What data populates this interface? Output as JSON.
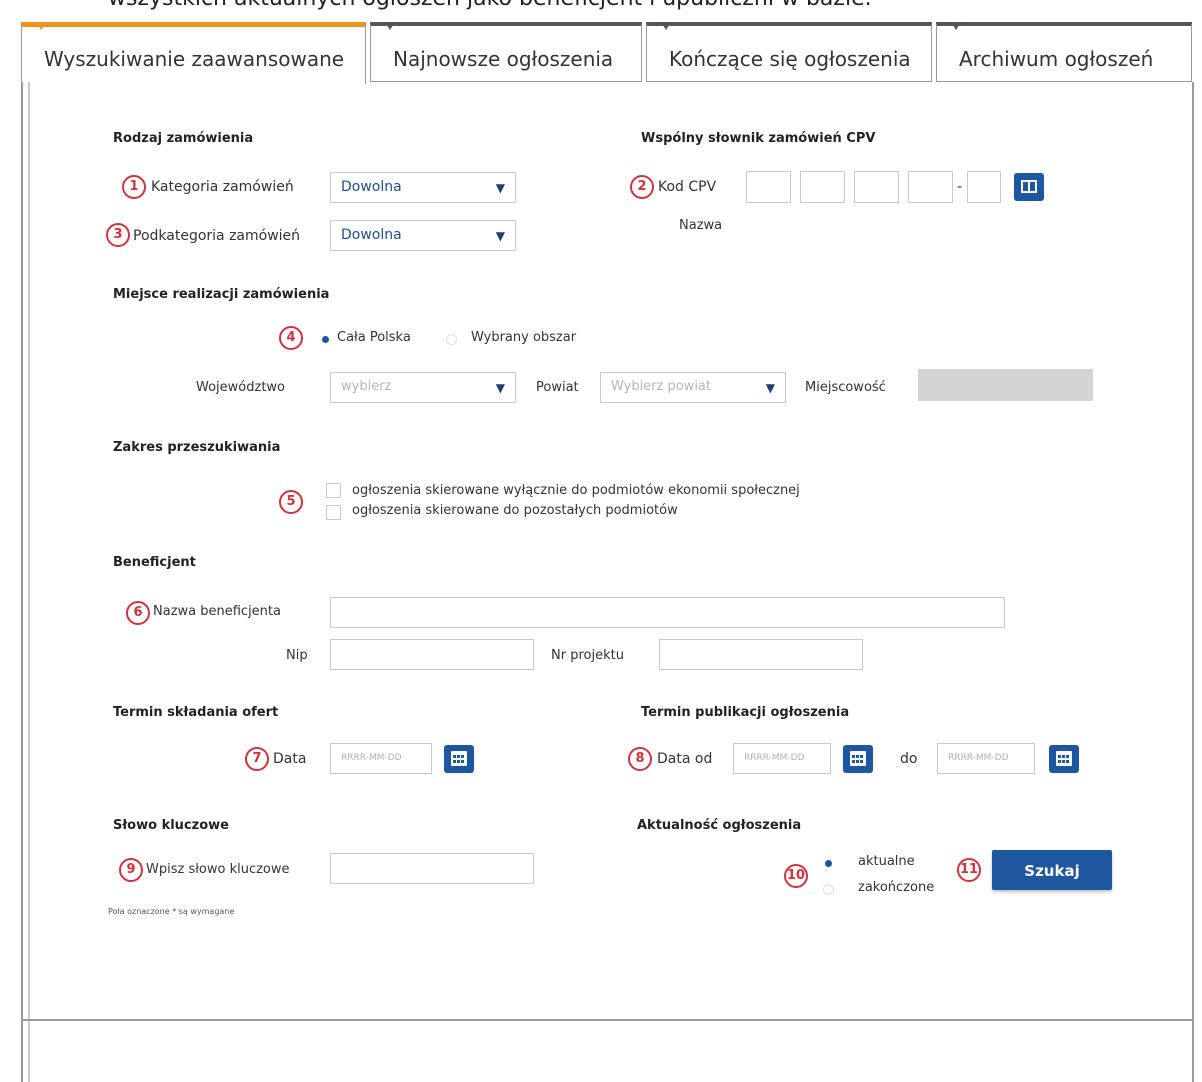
{
  "top_caption": "wszystkich aktualnych ogłoszeń jako beneficjent i upubliczni w bazie.",
  "tabs": [
    {
      "label": "Wyszukiwanie zaawansowane"
    },
    {
      "label": "Najnowsze ogłoszenia"
    },
    {
      "label": "Kończące się ogłoszenia"
    },
    {
      "label": "Archiwum ogłoszeń"
    }
  ],
  "order_type": {
    "title": "Rodzaj zamówienia",
    "category_label": "Kategoria zamówień",
    "category_value": "Dowolna",
    "subcategory_label": "Podkategoria zamówień",
    "subcategory_value": "Dowolna"
  },
  "cpv": {
    "title": "Wspólny słownik zamówień CPV",
    "code_label": "Kod CPV",
    "dash": "-",
    "name_label": "Nazwa"
  },
  "location": {
    "title": "Miejsce realizacji zamówienia",
    "option_all": "Cała Polska",
    "option_selected_area": "Wybrany obszar",
    "voivodeship_label": "Województwo",
    "voivodeship_placeholder": "wybierz",
    "county_label": "Powiat",
    "county_placeholder": "Wybierz powiat",
    "city_label": "Miejscowość"
  },
  "scope": {
    "title": "Zakres przeszukiwania",
    "option_social": "ogłoszenia skierowane wyłącznie do podmiotów ekonomii społecznej",
    "option_other": "ogłoszenia skierowane do pozostałych podmiotów"
  },
  "beneficiary": {
    "title": "Beneficjent",
    "name_label": "Nazwa beneficjenta",
    "nip_label": "Nip",
    "project_label": "Nr projektu"
  },
  "offer_deadline": {
    "title": "Termin składania ofert",
    "date_label": "Data",
    "date_placeholder": "RRRR-MM-DD"
  },
  "publication": {
    "title": "Termin publikacji ogłoszenia",
    "from_label": "Data od",
    "to_label": "do",
    "date_placeholder": "RRRR-MM-DD"
  },
  "keyword": {
    "title": "Słowo kluczowe",
    "label": "Wpisz słowo kluczowe"
  },
  "status": {
    "title": "Aktualność ogłoszenia",
    "option_current": "aktualne",
    "option_finished": "zakończone"
  },
  "search_button": "Szukaj",
  "footnote": "Pola oznaczone * są wymagane",
  "markers": [
    "1",
    "2",
    "3",
    "4",
    "5",
    "6",
    "7",
    "8",
    "9",
    "10",
    "11"
  ],
  "colors": {
    "accent": "#1f56a0",
    "marker": "#d2323c",
    "active_tab": "#f0921e"
  }
}
